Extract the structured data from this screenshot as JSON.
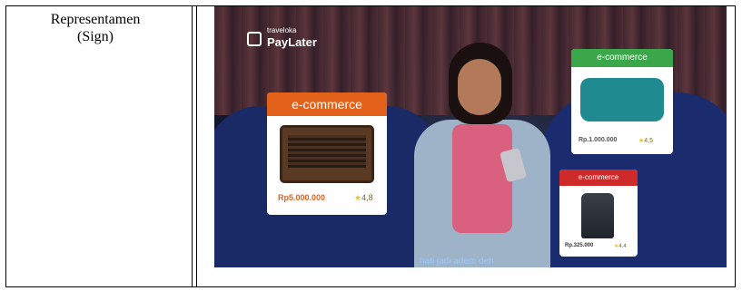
{
  "table": {
    "row_label_line1": "Representamen",
    "row_label_line2": "(Sign)"
  },
  "image": {
    "logo": {
      "small_text": "traveloka",
      "main_text": "PayLater",
      "icon": "paylater-icon"
    },
    "cards": [
      {
        "tag": "e-commerce",
        "price": "Rp5.000.000",
        "rating": "4,8",
        "tag_color": "#e2621c"
      },
      {
        "tag": "e-commerce",
        "price": "Rp.1.000.000",
        "rating": "4,5",
        "tag_color": "#3aa84a"
      },
      {
        "tag": "e-commerce",
        "price": "Rp.325.000",
        "rating": "4,4",
        "tag_color": "#cf2a2a"
      }
    ],
    "caption": "hati jadi adem deh"
  }
}
